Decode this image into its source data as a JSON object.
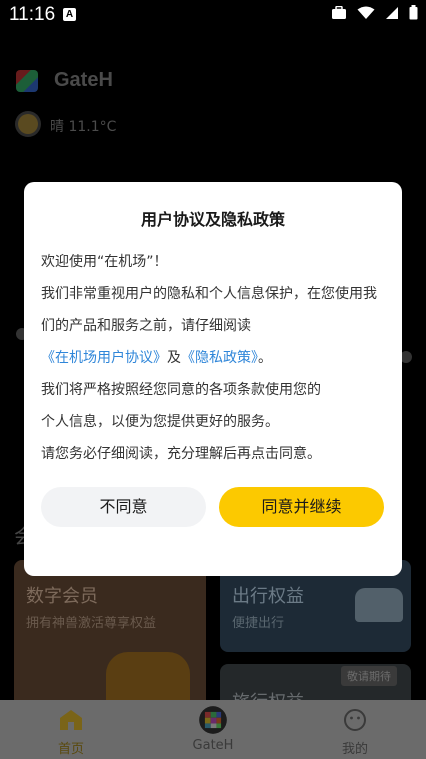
{
  "status_bar": {
    "time": "11:16",
    "notification_badge": "A",
    "icons": [
      "briefcase-icon",
      "wifi-icon",
      "signal-icon",
      "battery-icon"
    ]
  },
  "header": {
    "app_name": "GateH",
    "weather": "晴 11.1°C"
  },
  "background_cards": {
    "peek_text": "会",
    "digital_member": {
      "title": "数字会员",
      "subtitle": "拥有神兽激活尊享权益"
    },
    "travel_benefit": {
      "title": "出行权益",
      "subtitle": "便捷出行"
    },
    "trip_benefit": {
      "title": "旅行权益",
      "badge": "敬请期待"
    }
  },
  "tabbar": {
    "items": [
      {
        "label": "首页",
        "icon": "home-icon",
        "active": true
      },
      {
        "label": "GateH",
        "icon": "gateh-cube-icon",
        "active": false
      },
      {
        "label": "我的",
        "icon": "profile-face-icon",
        "active": false
      }
    ]
  },
  "dialog": {
    "title": "用户协议及隐私政策",
    "line1": "欢迎使用“在机场”！",
    "line2": "我们非常重视用户的隐私和个人信息保护，在您使用我",
    "line3": "们的产品和服务之前，请仔细阅读",
    "link_agreement": "《在机场用户协议》",
    "and_text": "及",
    "link_privacy": "《隐私政策》",
    "period": "。",
    "line5": "我们将严格按照经您同意的各项条款使用您的",
    "line6": "个人信息，以便为您提供更好的服务。",
    "line7": "请您务必仔细阅读，充分理解后再点击同意。",
    "disagree_label": "不同意",
    "agree_label": "同意并继续"
  },
  "colors": {
    "accent": "#fcc900",
    "link": "#2f86d9",
    "overlay": "#000000"
  }
}
